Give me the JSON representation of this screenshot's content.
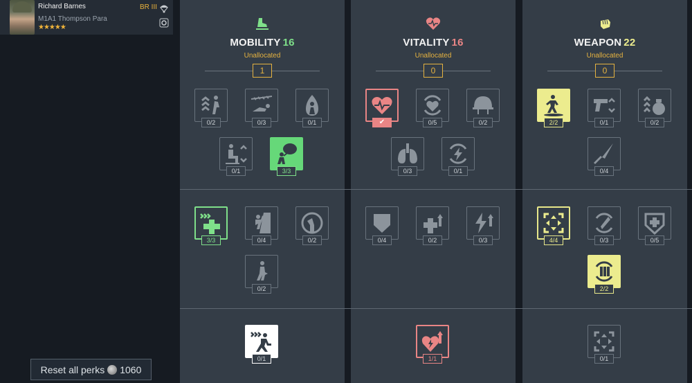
{
  "soldier": {
    "name": "Richard Barnes",
    "weapon": "M1A1 Thompson Para",
    "stars": "★★★★★",
    "br": "BR III"
  },
  "reset": {
    "label": "Reset all perks",
    "cost": "1060"
  },
  "columns": [
    {
      "title": "MOBILITY",
      "points": "16",
      "sub": "Unallocated",
      "alloc": "1",
      "color": "#7fe08a"
    },
    {
      "title": "VITALITY",
      "points": "16",
      "sub": "Unallocated",
      "alloc": "0",
      "color": "#e98585"
    },
    {
      "title": "WEAPON",
      "points": "22",
      "sub": "Unallocated",
      "alloc": "0",
      "color": "#ecec8e"
    }
  ],
  "perks": {
    "mobility": [
      "0/2",
      "0/3",
      "0/1",
      "0/1",
      "3/3",
      "3/3",
      "0/4",
      "0/2",
      "0/2",
      "0/1"
    ],
    "vitality": [
      "0/5",
      "0/2",
      "0/3",
      "0/1",
      "0/4",
      "0/2",
      "0/3",
      "1/1"
    ],
    "weapon": [
      "2/2",
      "0/1",
      "0/2",
      "0/4",
      "4/4",
      "0/3",
      "0/5",
      "2/2",
      "0/1"
    ]
  },
  "icons": [
    "boot-icon",
    "heart-icon",
    "fist-icon",
    "parachute-icon",
    "medal-icon",
    "coin-icon"
  ]
}
